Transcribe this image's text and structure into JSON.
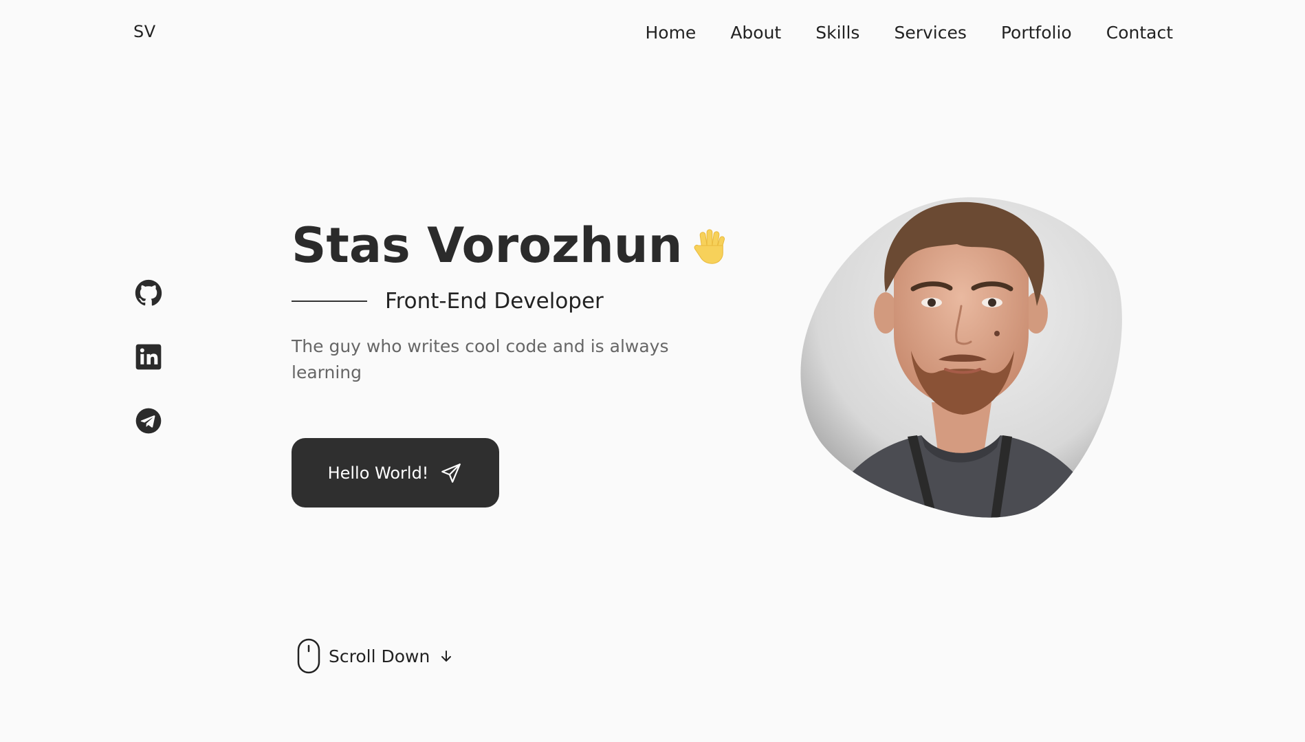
{
  "header": {
    "logo": "SV",
    "nav": [
      {
        "label": "Home"
      },
      {
        "label": "About"
      },
      {
        "label": "Skills"
      },
      {
        "label": "Services"
      },
      {
        "label": "Portfolio"
      },
      {
        "label": "Contact"
      }
    ]
  },
  "social": [
    {
      "icon": "github-icon"
    },
    {
      "icon": "linkedin-icon"
    },
    {
      "icon": "telegram-icon"
    }
  ],
  "hero": {
    "name": "Stas Vorozhun",
    "emoji": "waving-hand-icon",
    "role": "Front-End Developer",
    "description": "The guy who writes cool code and is always learning",
    "cta_label": "Hello World!",
    "cta_icon": "send-icon",
    "photo": "profile-photo"
  },
  "scroll": {
    "label": "Scroll Down",
    "icon": "mouse-icon",
    "arrow": "arrow-down-icon"
  },
  "colors": {
    "background": "#fafafa",
    "primary_text": "#2b2b2b",
    "muted_text": "#666666",
    "button": "#2f2f2f",
    "accent_emoji": "#f7d15a"
  }
}
